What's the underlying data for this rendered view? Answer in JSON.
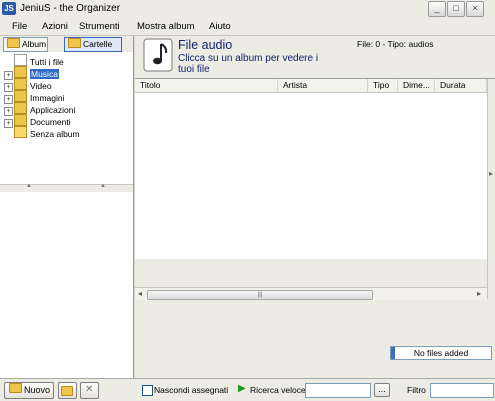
{
  "window": {
    "title": "JeniuS - the Organizer",
    "icon_text": "JS"
  },
  "menu": [
    "File",
    "Azioni",
    "Strumenti",
    "Mostra album",
    "Aiuto"
  ],
  "left_panel": {
    "tab_album": "Album",
    "tab_folders": "Cartelle",
    "tree": [
      {
        "label": "Tutti i file",
        "icon": "all-files-icon"
      },
      {
        "label": "Musica",
        "icon": "music-folder-icon",
        "selected": true
      },
      {
        "label": "Video",
        "icon": "video-folder-icon"
      },
      {
        "label": "Immagini",
        "icon": "images-folder-icon"
      },
      {
        "label": "Applicazioni",
        "icon": "applications-folder-icon"
      },
      {
        "label": "Documenti",
        "icon": "documents-folder-icon"
      },
      {
        "label": "Senza album",
        "icon": "no-album-icon"
      }
    ]
  },
  "main": {
    "title": "File audio",
    "subtitle": "Clicca su un album per vedere i tuoi file",
    "info": "File: 0  -  Tipo: audios",
    "columns": [
      "Titolo",
      "Artista",
      "Tipo",
      "Dime...",
      "Durata"
    ],
    "rows": [],
    "status_text": "No files added",
    "status_progress": 0.04
  },
  "bottom": {
    "new_button": "Nuovo",
    "hide_assigned": "Nascondi assegnati",
    "quick_search": "Ricerca veloce",
    "browse_button": "...",
    "filter_label": "Filtro"
  },
  "colors": {
    "accent": "#316ac5",
    "header_text": "#10226b"
  }
}
